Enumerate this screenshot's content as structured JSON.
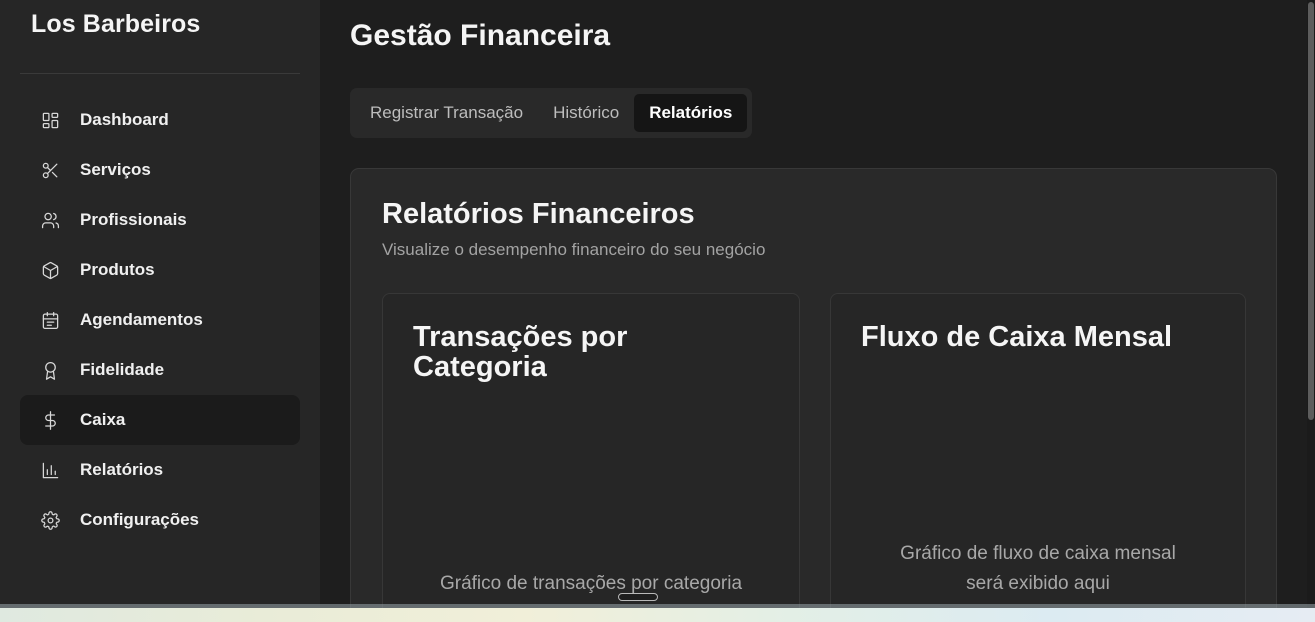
{
  "sidebar": {
    "brand": "Los Barbeiros",
    "items": [
      {
        "label": "Dashboard",
        "icon": "dashboard-icon"
      },
      {
        "label": "Serviços",
        "icon": "scissors-icon"
      },
      {
        "label": "Profissionais",
        "icon": "users-icon"
      },
      {
        "label": "Produtos",
        "icon": "box-icon"
      },
      {
        "label": "Agendamentos",
        "icon": "calendar-icon"
      },
      {
        "label": "Fidelidade",
        "icon": "award-icon"
      },
      {
        "label": "Caixa",
        "icon": "dollar-icon",
        "active": true
      },
      {
        "label": "Relatórios",
        "icon": "bar-chart-icon"
      },
      {
        "label": "Configurações",
        "icon": "settings-icon"
      }
    ]
  },
  "main": {
    "title": "Gestão Financeira",
    "tabs": [
      {
        "label": "Registrar Transação"
      },
      {
        "label": "Histórico"
      },
      {
        "label": "Relatórios",
        "active": true
      }
    ],
    "report": {
      "title": "Relatórios Financeiros",
      "subtitle": "Visualize o desempenho financeiro do seu negócio",
      "cards": [
        {
          "title": "Transações por Categoria",
          "placeholder": "Gráfico de transações por categoria"
        },
        {
          "title": "Fluxo de Caixa Mensal",
          "placeholder": "Gráfico de fluxo de caixa mensal será exibido aqui"
        }
      ]
    }
  },
  "colors": {
    "sidebar_bg": "#262626",
    "main_bg": "#1e1e1e",
    "card_bg": "#292929",
    "active_bg": "#1b1b1b"
  }
}
